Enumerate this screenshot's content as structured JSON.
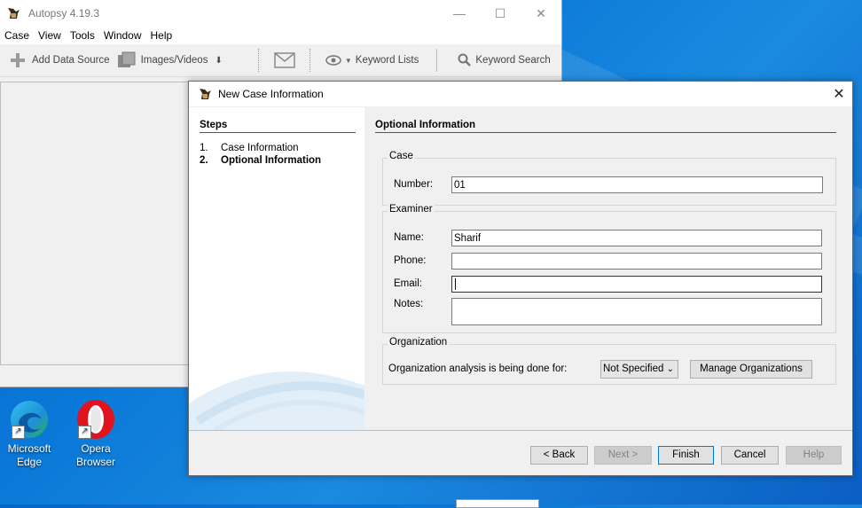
{
  "main_window": {
    "title": "Autopsy 4.19.3",
    "controls": {
      "minimize": "—",
      "maximize": "☐",
      "close": "✕"
    },
    "menu": [
      "Case",
      "View",
      "Tools",
      "Window",
      "Help"
    ],
    "toolbar": {
      "add_data_source": "Add Data Source",
      "images_videos": "Images/Videos",
      "keyword_lists": "Keyword Lists",
      "keyword_search": "Keyword Search"
    }
  },
  "desktop": {
    "icons": [
      {
        "label_line1": "Microsoft",
        "label_line2": "Edge"
      },
      {
        "label_line1": "Opera",
        "label_line2": "Browser"
      }
    ]
  },
  "dialog": {
    "title": "New Case Information",
    "close": "✕",
    "steps": {
      "heading": "Steps",
      "items": [
        {
          "num": "1.",
          "label": "Case Information"
        },
        {
          "num": "2.",
          "label": "Optional Information"
        }
      ]
    },
    "panel": {
      "heading": "Optional Information",
      "case_group": {
        "title": "Case",
        "number_label": "Number:",
        "number_value": "01"
      },
      "examiner_group": {
        "title": "Examiner",
        "name_label": "Name:",
        "name_value": "Sharif",
        "phone_label": "Phone:",
        "phone_value": "",
        "email_label": "Email:",
        "email_value": "",
        "notes_label": "Notes:",
        "notes_value": ""
      },
      "organization_group": {
        "title": "Organization",
        "analysis_label": "Organization analysis is being done for:",
        "selected": "Not Specified",
        "manage_button": "Manage Organizations"
      }
    },
    "buttons": {
      "back": "< Back",
      "next": "Next >",
      "finish": "Finish",
      "cancel": "Cancel",
      "help": "Help"
    }
  }
}
